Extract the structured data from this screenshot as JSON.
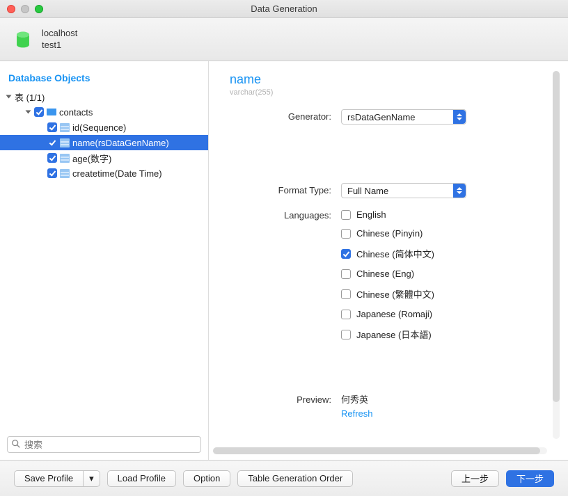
{
  "window": {
    "title": "Data Generation"
  },
  "connection": {
    "host": "localhost",
    "database": "test1"
  },
  "sidebar": {
    "heading": "Database Objects",
    "root_label": "表 (1/1)",
    "table": "contacts",
    "columns": [
      {
        "label": "id(Sequence)",
        "checked": true,
        "selected": false
      },
      {
        "label": "name(rsDataGenName)",
        "checked": true,
        "selected": true
      },
      {
        "label": "age(数字)",
        "checked": true,
        "selected": false
      },
      {
        "label": "createtime(Date Time)",
        "checked": true,
        "selected": false
      }
    ],
    "search_placeholder": "搜索"
  },
  "panel": {
    "field_name": "name",
    "field_type": "varchar(255)",
    "labels": {
      "generator": "Generator:",
      "format_type": "Format Type:",
      "languages": "Languages:",
      "preview": "Preview:"
    },
    "generator_value": "rsDataGenName",
    "format_type_value": "Full Name",
    "languages": [
      {
        "label": "English",
        "checked": false
      },
      {
        "label": "Chinese (Pinyin)",
        "checked": false
      },
      {
        "label": "Chinese (简体中文)",
        "checked": true
      },
      {
        "label": "Chinese (Eng)",
        "checked": false
      },
      {
        "label": "Chinese (繁體中文)",
        "checked": false
      },
      {
        "label": "Japanese (Romaji)",
        "checked": false
      },
      {
        "label": "Japanese (日本語)",
        "checked": false
      }
    ],
    "preview_value": "何秀英",
    "refresh_label": "Refresh"
  },
  "footer": {
    "save_profile": "Save Profile",
    "dropdown_indicator": "▾",
    "load_profile": "Load Profile",
    "option": "Option",
    "table_gen_order": "Table Generation Order",
    "prev": "上一步",
    "next": "下一步"
  }
}
